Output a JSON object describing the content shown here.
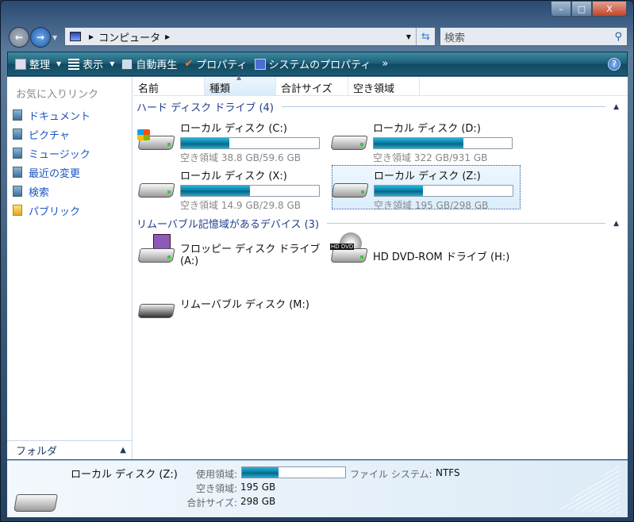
{
  "window": {
    "caption": {
      "minimize": "–",
      "maximize": "□",
      "close": "X"
    }
  },
  "address": {
    "segments": [
      "コンピュータ"
    ],
    "search_placeholder": "検索"
  },
  "toolbar": {
    "organize": "整理",
    "views": "表示",
    "autoplay": "自動再生",
    "properties": "プロパティ",
    "system_properties": "システムのプロパティ",
    "more": "»",
    "help": "?"
  },
  "sidebar": {
    "title": "お気に入りリンク",
    "items": [
      {
        "label": "ドキュメント"
      },
      {
        "label": "ピクチャ"
      },
      {
        "label": "ミュージック"
      },
      {
        "label": "最近の変更"
      },
      {
        "label": "検索"
      },
      {
        "label": "パブリック"
      }
    ],
    "folders": "フォルダ"
  },
  "columns": [
    "名前",
    "種類",
    "合計サイズ",
    "空き領域"
  ],
  "groups": [
    {
      "title": "ハード ディスク ドライブ (4)",
      "items": [
        {
          "name": "ローカル ディスク (C:)",
          "free": "空き領域 38.8 GB/59.6 GB",
          "used_fraction": 0.35,
          "icon": "windows-drive"
        },
        {
          "name": "ローカル ディスク (D:)",
          "free": "空き領域 322 GB/931 GB",
          "used_fraction": 0.65,
          "icon": "hard-drive"
        },
        {
          "name": "ローカル ディスク (X:)",
          "free": "空き領域 14.9 GB/29.8 GB",
          "used_fraction": 0.5,
          "icon": "hard-drive"
        },
        {
          "name": "ローカル ディスク (Z:)",
          "free": "空き領域 195 GB/298 GB",
          "used_fraction": 0.35,
          "icon": "hard-drive",
          "selected": true
        }
      ]
    },
    {
      "title": "リムーバブル記憶域があるデバイス (3)",
      "items": [
        {
          "name": "フロッピー ディスク ドライブ",
          "name2": "(A:)",
          "icon": "floppy-drive"
        },
        {
          "name": "HD DVD-ROM ドライブ (H:)",
          "icon": "dvd-drive",
          "badge": "HD DVD"
        },
        {
          "name": "リムーバブル ディスク (M:)",
          "icon": "removable-drive"
        }
      ]
    }
  ],
  "details": {
    "name": "ローカル ディスク (Z:)",
    "used_label": "使用領域:",
    "used_fraction": 0.35,
    "fs_label": "ファイル システム:",
    "fs_value": "NTFS",
    "free_label": "空き領域:",
    "free_value": "195 GB",
    "total_label": "合計サイズ:",
    "total_value": "298 GB"
  }
}
